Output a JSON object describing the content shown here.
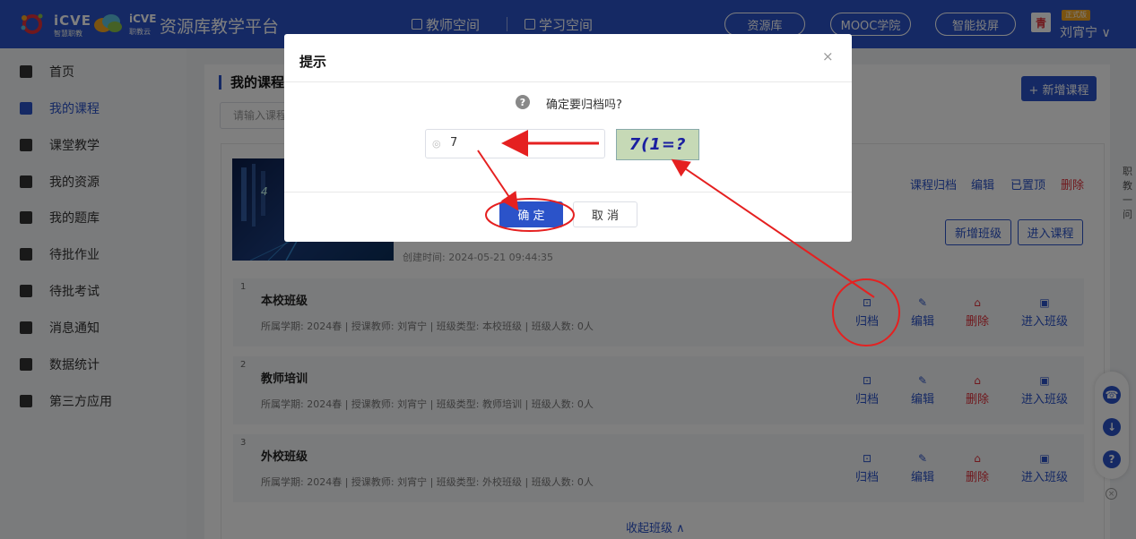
{
  "header": {
    "brand1": "iCVE",
    "brand1_sub": "智慧职教",
    "brand2": "iCVE",
    "brand2_sub": "职教云",
    "platform_title": "资源库教学平台",
    "space_teacher": "教师空间",
    "space_study": "学习空间",
    "nav_links": [
      "资源库",
      "MOOC学院",
      "智能投屏"
    ],
    "avatar_glyph": "青",
    "vip_badge": "正式版",
    "user_name": "刘宵宁 ∨"
  },
  "sidebar": {
    "items": [
      {
        "label": "首页",
        "icon": "home-icon"
      },
      {
        "label": "我的课程",
        "icon": "book-icon",
        "active": true
      },
      {
        "label": "课堂教学",
        "icon": "classroom-icon"
      },
      {
        "label": "我的资源",
        "icon": "resource-icon"
      },
      {
        "label": "我的题库",
        "icon": "question-bank-icon"
      },
      {
        "label": "待批作业",
        "icon": "homework-icon"
      },
      {
        "label": "待批考试",
        "icon": "exam-icon"
      },
      {
        "label": "消息通知",
        "icon": "message-icon"
      },
      {
        "label": "数据统计",
        "icon": "stats-icon"
      },
      {
        "label": "第三方应用",
        "icon": "apps-icon"
      }
    ]
  },
  "main": {
    "section_title": "我的课程",
    "search_placeholder": "请输入课程",
    "add_course": "+ 新增课程",
    "course": {
      "thumb_number": "4",
      "created_time": "创建时间: 2024-05-21 09:44:35",
      "actions": [
        "课程归档",
        "编辑",
        "已置顶",
        "删除"
      ],
      "add_class": "新增班级",
      "enter_course": "进入课程"
    },
    "classes": [
      {
        "index": "1",
        "name": "本校班级",
        "meta": "所属学期: 2024春  |  授课教师: 刘宵宁  |  班级类型: 本校班级  |  班级人数: 0人"
      },
      {
        "index": "2",
        "name": "教师培训",
        "meta": "所属学期: 2024春  |  授课教师: 刘宵宁  |  班级类型: 教师培训  |  班级人数: 0人"
      },
      {
        "index": "3",
        "name": "外校班级",
        "meta": "所属学期: 2024春  |  授课教师: 刘宵宁  |  班级类型: 外校班级  |  班级人数: 0人"
      }
    ],
    "row_actions": {
      "archive": "归档",
      "edit": "编辑",
      "delete": "删除",
      "enter_class": "进入班级"
    },
    "collapse": "收起班级 ∧"
  },
  "right_strip_text": "职教一问",
  "float_tools": [
    "service-icon",
    "download-icon",
    "help-icon"
  ],
  "dialog": {
    "title": "提示",
    "close": "×",
    "question": "确定要归档吗?",
    "captcha_value": "7",
    "captcha_image_text": "7(1=?",
    "confirm": "确 定",
    "cancel": "取 消"
  },
  "colors": {
    "primary": "#2b53c9",
    "danger": "#e0303a",
    "annotation": "#e52020"
  }
}
